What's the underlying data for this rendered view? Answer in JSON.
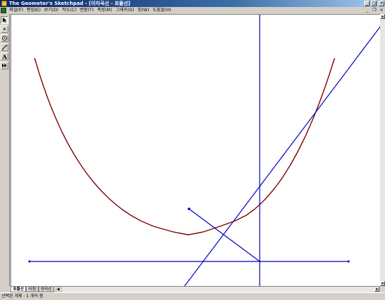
{
  "titlebar": {
    "title": "The Geometer's Sketchpad - [이차곡선 - 포물선]",
    "minimize_label": "_",
    "maximize_label": "□",
    "close_label": "×"
  },
  "menubar": {
    "items": [
      {
        "label": "파일(F)"
      },
      {
        "label": "편집(E)"
      },
      {
        "label": "보기(D)"
      },
      {
        "label": "작도(C)"
      },
      {
        "label": "변환(T)"
      },
      {
        "label": "측정(M)"
      },
      {
        "label": "그래프(G)"
      },
      {
        "label": "창(W)"
      },
      {
        "label": "도움말(H)"
      }
    ],
    "doc_minimize": "_",
    "doc_restore": "❐",
    "doc_close": "×"
  },
  "toolbox": {
    "tools": [
      {
        "name": "selection-arrow-tool",
        "icon": "arrow-icon",
        "active": true
      },
      {
        "name": "point-tool",
        "icon": "point-icon",
        "active": false
      },
      {
        "name": "compass-tool",
        "icon": "circle-icon",
        "active": false
      },
      {
        "name": "straightedge-tool",
        "icon": "line-icon",
        "active": false
      },
      {
        "name": "text-tool",
        "icon": "text-icon",
        "label": "A",
        "active": false
      },
      {
        "name": "custom-tool",
        "icon": "double-arrow-icon",
        "active": false
      }
    ]
  },
  "pages": {
    "tabs": [
      {
        "label": "포물선",
        "active": true
      },
      {
        "label": "타원",
        "active": false
      },
      {
        "label": "쌍곡선",
        "active": false
      }
    ],
    "nav_label": "◀"
  },
  "status": {
    "text": "선택된 개체 : 1 개의 점"
  },
  "colors": {
    "parabola": "#800000",
    "construction": "#0000c0",
    "canvas_bg": "#ffffff",
    "window_chrome": "#d4d0c8"
  }
}
